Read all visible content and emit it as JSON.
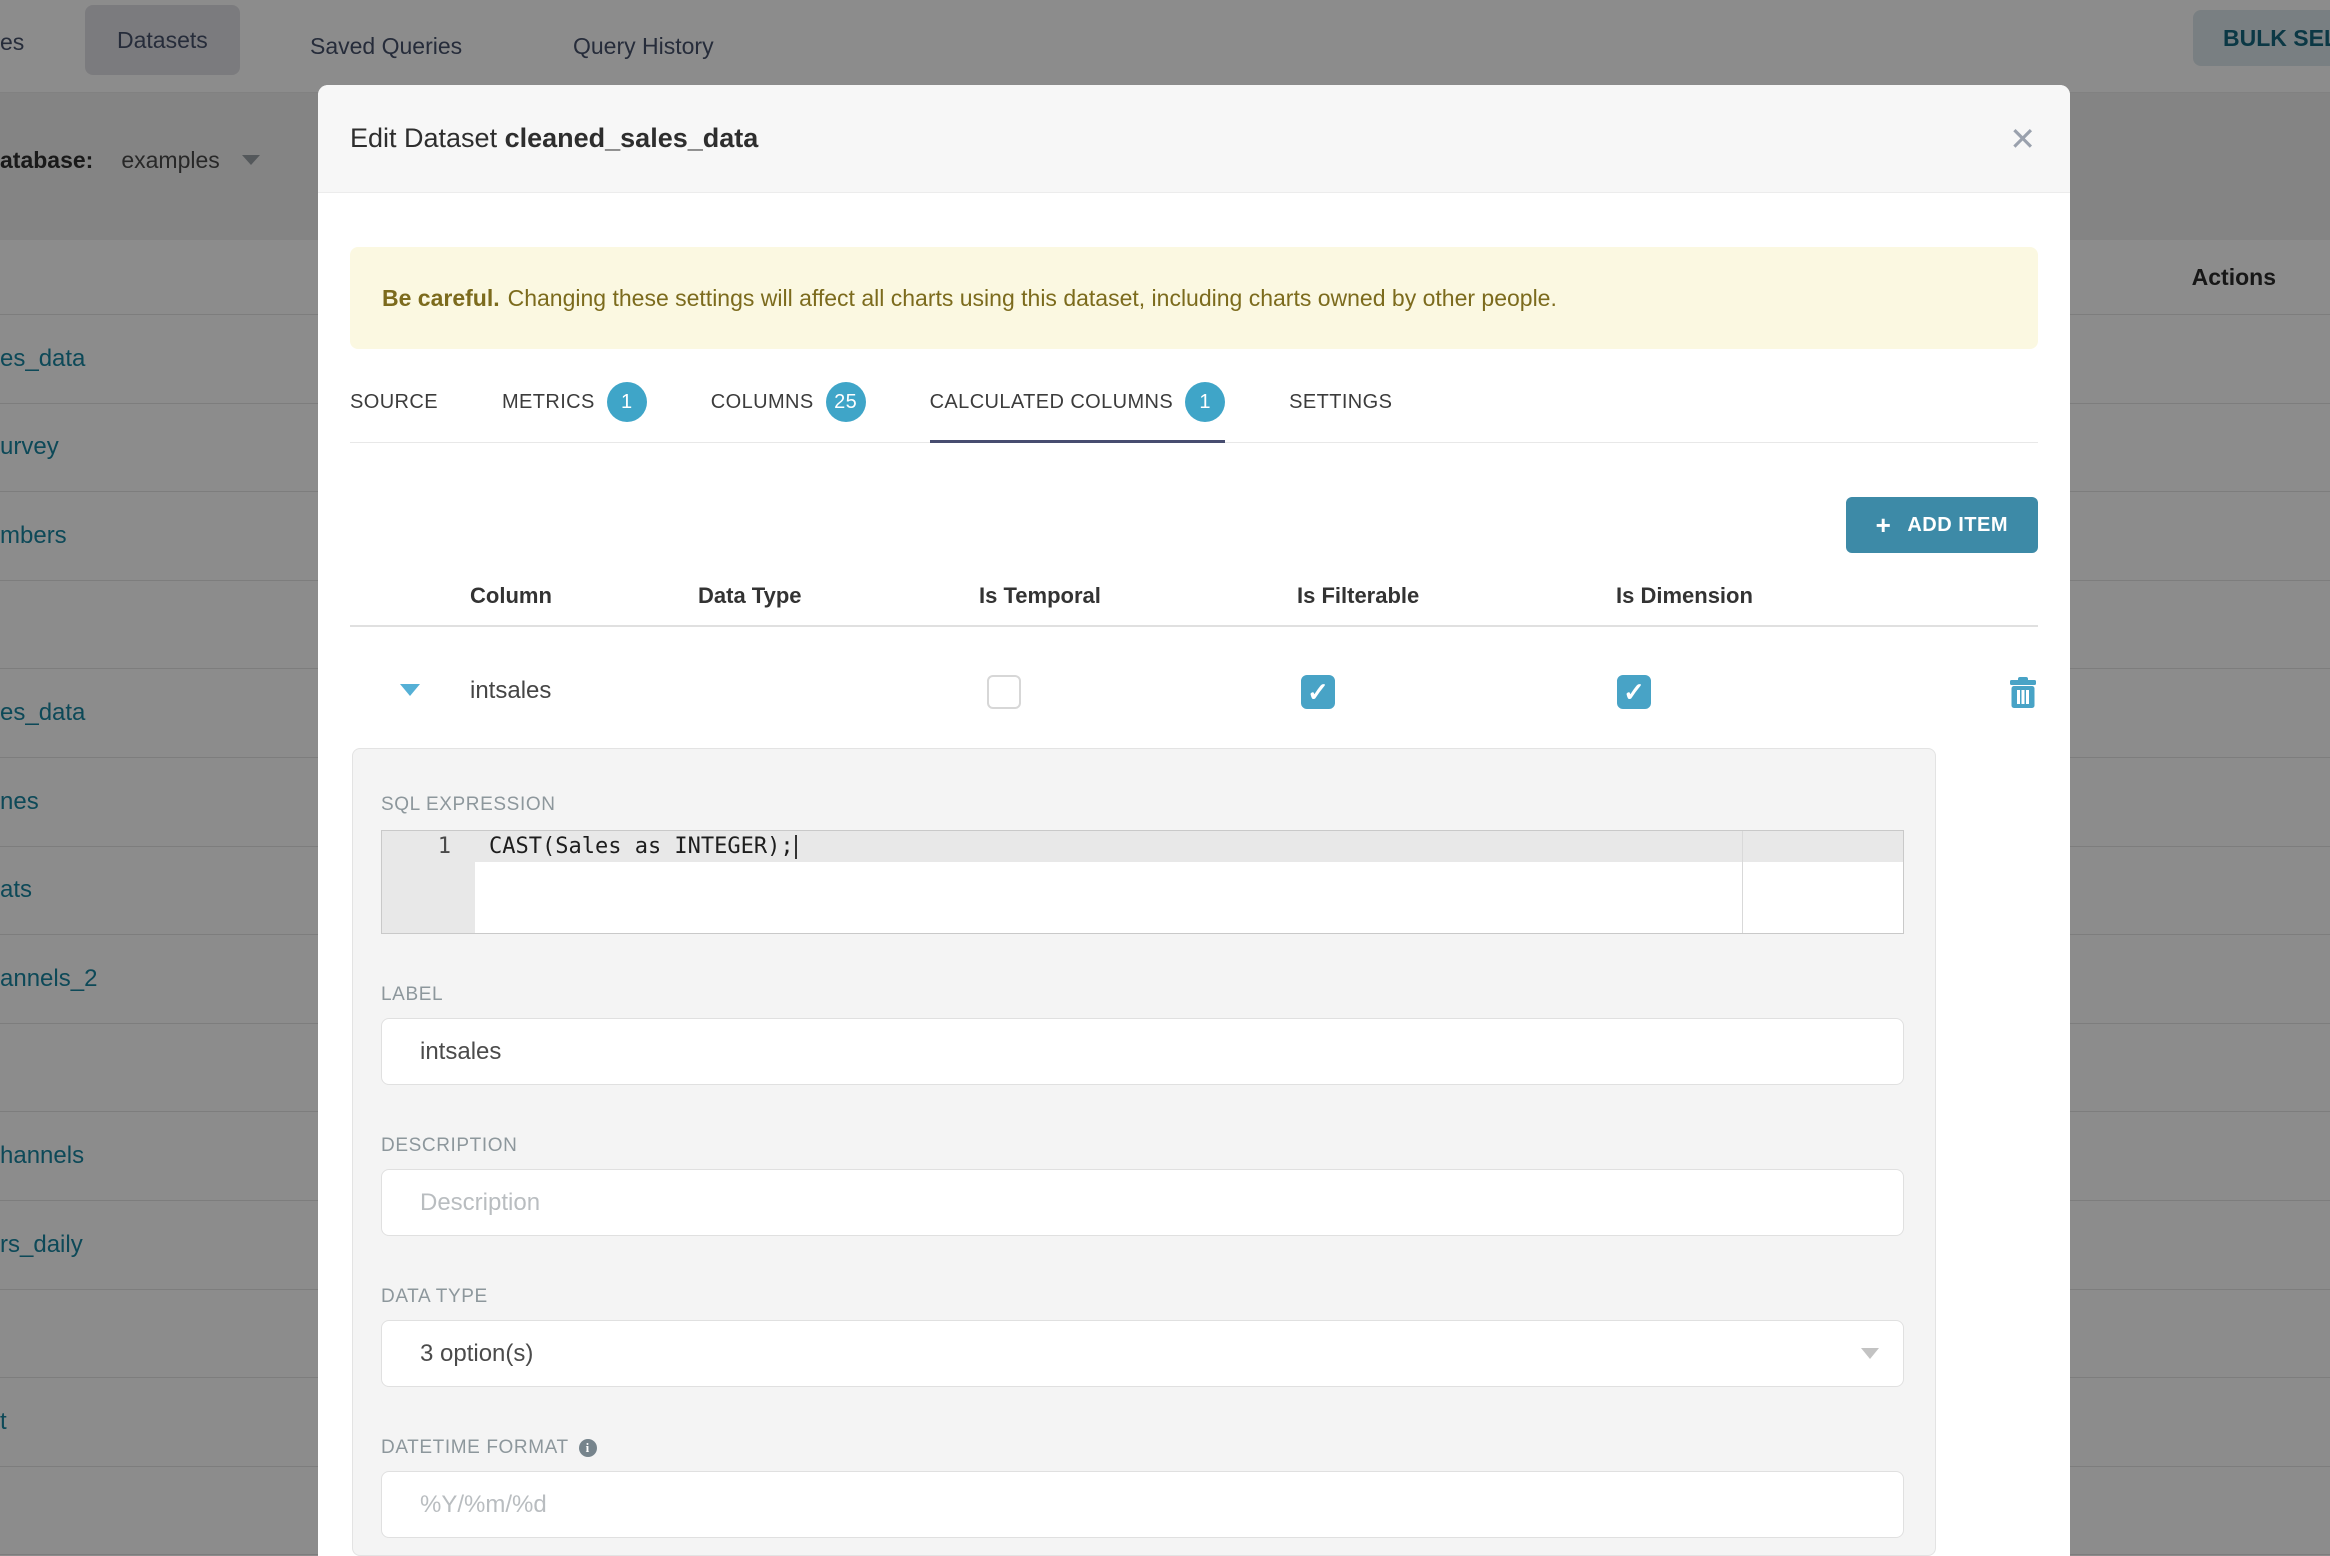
{
  "background": {
    "nav": {
      "clipped_tab_fragment": "es",
      "tabs": [
        "Datasets",
        "Saved Queries",
        "Query History"
      ],
      "active_tab": "Datasets",
      "bulk_select_label": "BULK SELE"
    },
    "database_label_fragment": "atabase:",
    "database_value": "examples",
    "actions_header": "Actions",
    "dataset_link_fragments": [
      "es_data",
      "urvey",
      "mbers",
      "",
      "es_data",
      "nes",
      "ats",
      "annels_2",
      "",
      "hannels",
      "rs_daily",
      "",
      "t",
      ""
    ]
  },
  "modal": {
    "title_prefix": "Edit Dataset",
    "title_dataset": "cleaned_sales_data",
    "close_glyph": "✕",
    "warning": {
      "bold": "Be careful.",
      "text": "Changing these settings will affect all charts using this dataset, including charts owned by other people."
    },
    "tabs": [
      {
        "label": "SOURCE"
      },
      {
        "label": "METRICS",
        "badge": "1"
      },
      {
        "label": "COLUMNS",
        "badge": "25"
      },
      {
        "label": "CALCULATED COLUMNS",
        "badge": "1",
        "active": true
      },
      {
        "label": "SETTINGS"
      }
    ],
    "add_item": {
      "plus": "+",
      "label": "ADD ITEM"
    },
    "table": {
      "headers": [
        "Column",
        "Data Type",
        "Is Temporal",
        "Is Filterable",
        "Is Dimension"
      ],
      "row": {
        "name": "intsales",
        "is_temporal": false,
        "is_filterable": true,
        "is_dimension": true,
        "check_glyph": "✓"
      }
    },
    "panel": {
      "sql_label": "SQL EXPRESSION",
      "sql_line_number": "1",
      "sql_code": "CAST(Sales as INTEGER);",
      "label_label": "LABEL",
      "label_value": "intsales",
      "description_label": "DESCRIPTION",
      "description_placeholder": "Description",
      "datatype_label": "DATA TYPE",
      "datatype_value": "3 option(s)",
      "datetime_label": "DATETIME FORMAT",
      "datetime_info": "i",
      "datetime_placeholder": "%Y/%m/%d"
    }
  },
  "colors": {
    "accent_teal": "#3fa5c8",
    "button_teal": "#3d8aa7",
    "link_teal": "#1985a0",
    "active_tab_underline": "#474d70",
    "warning_bg": "#fbf8e1",
    "warning_text": "#7c6b1d"
  }
}
